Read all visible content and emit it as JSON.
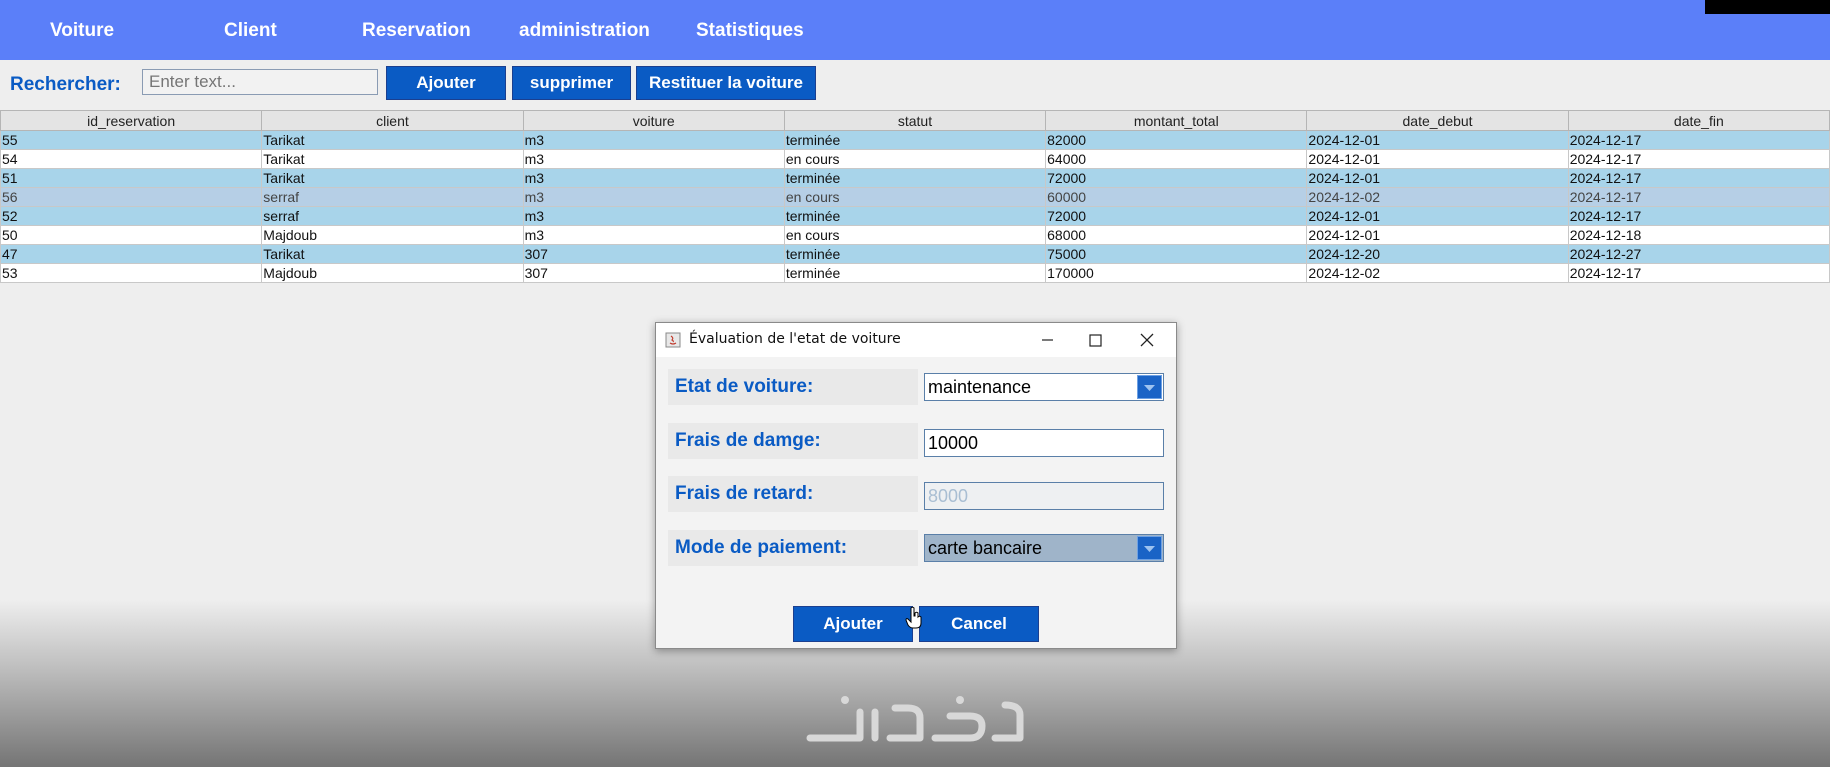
{
  "menubar": {
    "items": [
      "Voiture",
      "Client",
      "Reservation",
      "administration",
      "Statistiques"
    ]
  },
  "toolbar": {
    "search_label": "Rechercher:",
    "search_placeholder": "Enter text...",
    "add_label": "Ajouter",
    "delete_label": "supprimer",
    "return_label": "Restituer la voiture"
  },
  "table": {
    "columns": [
      "id_reservation",
      "client",
      "voiture",
      "statut",
      "montant_total",
      "date_debut",
      "date_fin"
    ],
    "rows": [
      [
        "55",
        "Tarikat",
        "m3",
        "terminée",
        "82000",
        "2024-12-01",
        "2024-12-17"
      ],
      [
        "54",
        "Tarikat",
        "m3",
        "en cours",
        "64000",
        "2024-12-01",
        "2024-12-17"
      ],
      [
        "51",
        "Tarikat",
        "m3",
        "terminée",
        "72000",
        "2024-12-01",
        "2024-12-17"
      ],
      [
        "56",
        "serraf",
        "m3",
        "en cours",
        "60000",
        "2024-12-02",
        "2024-12-17"
      ],
      [
        "52",
        "serraf",
        "m3",
        "terminée",
        "72000",
        "2024-12-01",
        "2024-12-17"
      ],
      [
        "50",
        "Majdoub",
        "m3",
        "en cours",
        "68000",
        "2024-12-01",
        "2024-12-18"
      ],
      [
        "47",
        "Tarikat",
        "307",
        "terminée",
        "75000",
        "2024-12-20",
        "2024-12-27"
      ],
      [
        "53",
        "Majdoub",
        "307",
        "terminée",
        "170000",
        "2024-12-02",
        "2024-12-17"
      ]
    ]
  },
  "dialog": {
    "title": "Évaluation de l'etat de voiture",
    "etat_label": "Etat de voiture:",
    "etat_value": "maintenance",
    "damage_label": "Frais de damge:",
    "damage_value": "10000",
    "retard_label": "Frais de retard:",
    "retard_value": "8000",
    "payment_label": "Mode de paiement:",
    "payment_value": "carte bancaire",
    "ok_label": "Ajouter",
    "cancel_label": "Cancel"
  },
  "colors": {
    "menubar": "#5b7ff9",
    "accent": "#0a5bc4",
    "row_blue": "#a8d4ea",
    "row_selected": "#b6cfe6"
  }
}
